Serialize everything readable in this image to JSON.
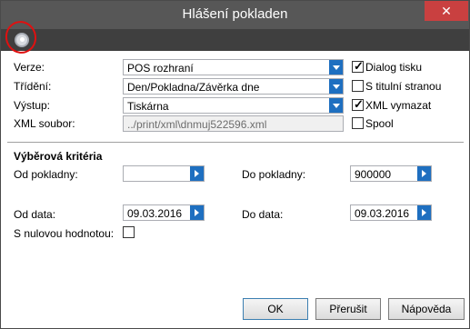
{
  "window": {
    "title": "Hlášení pokladen",
    "close_glyph": "✕"
  },
  "toolbar": {
    "icon": "disc-icon",
    "logo": "i/2"
  },
  "form": {
    "verze": {
      "label": "Verze:",
      "value": "POS rozhraní"
    },
    "trideni": {
      "label": "Třídění:",
      "value": "Den/Pokladna/Závěrka dne"
    },
    "vystup": {
      "label": "Výstup:",
      "value": "Tiskárna"
    },
    "xml_soubor": {
      "label": "XML soubor:",
      "value": "../print/xml\\dnmuj522596.xml"
    },
    "checks": {
      "dialog_tisku": {
        "label": "Dialog tisku",
        "checked": true
      },
      "s_titulni_stranou": {
        "label": "S titulní stranou",
        "checked": false
      },
      "xml_vymazat": {
        "label": "XML vymazat",
        "checked": true
      },
      "spool": {
        "label": "Spool",
        "checked": false
      }
    }
  },
  "criteria": {
    "heading": "Výběrová kritéria",
    "od_pokladny": {
      "label": "Od pokladny:",
      "value": ""
    },
    "do_pokladny": {
      "label": "Do pokladny:",
      "value": "900000"
    },
    "od_data": {
      "label": "Od data:",
      "value": "09.03.2016"
    },
    "do_data": {
      "label": "Do data:",
      "value": "09.03.2016"
    },
    "s_nulovou": {
      "label": "S nulovou hodnotou:",
      "checked": false
    }
  },
  "buttons": {
    "ok": "OK",
    "prerusit": "Přerušit",
    "napoveda": "Nápověda"
  }
}
